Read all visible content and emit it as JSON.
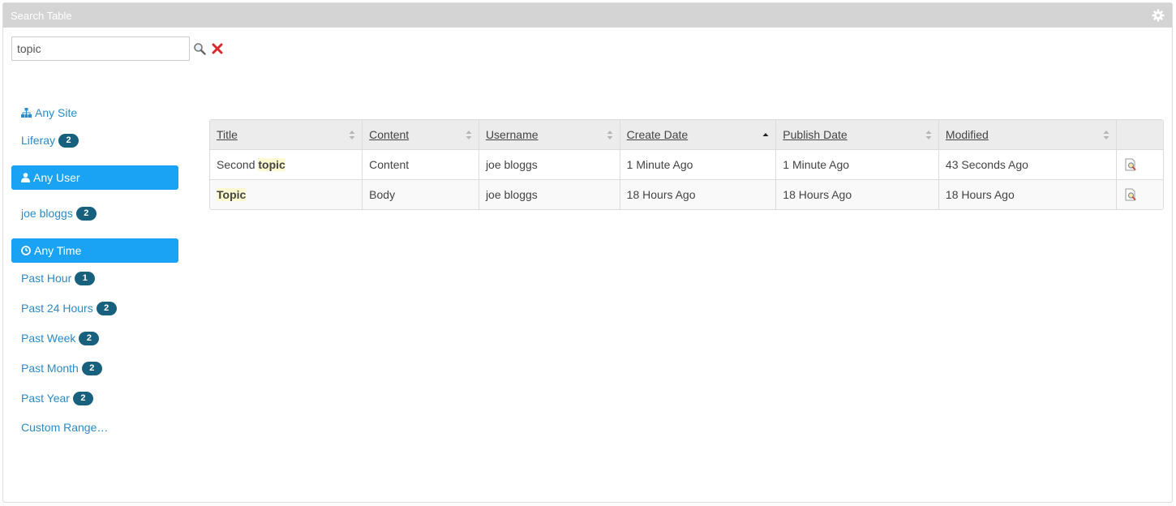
{
  "portlet": {
    "title": "Search Table",
    "settings_icon": "gear-icon"
  },
  "search": {
    "value": "topic",
    "placeholder": "",
    "search_icon": "magnifier-icon",
    "clear_icon": "red-x-icon"
  },
  "facets": {
    "site": {
      "header": "Any Site",
      "header_icon": "sitemap-icon",
      "items": [
        {
          "label": "Liferay",
          "count": "2"
        }
      ]
    },
    "user": {
      "header": "Any User",
      "header_icon": "user-icon",
      "items": [
        {
          "label": "joe bloggs",
          "count": "2"
        }
      ]
    },
    "time": {
      "header": "Any Time",
      "header_icon": "clock-icon",
      "items": [
        {
          "label": "Past Hour",
          "count": "1"
        },
        {
          "label": "Past 24 Hours",
          "count": "2"
        },
        {
          "label": "Past Week",
          "count": "2"
        },
        {
          "label": "Past Month",
          "count": "2"
        },
        {
          "label": "Past Year",
          "count": "2"
        }
      ],
      "custom_range": "Custom Range…"
    },
    "active_color": "#1aa3f4",
    "badge_color": "#17617f",
    "link_color": "#2a8bc8"
  },
  "table": {
    "columns": [
      "Title",
      "Content",
      "Username",
      "Create Date",
      "Publish Date",
      "Modified"
    ],
    "sorted_column": "Create Date",
    "sort_direction": "ascending",
    "rows": [
      {
        "title_prefix": "Second ",
        "title_highlight": "topic",
        "content": "Content",
        "username": "joe bloggs",
        "create_date": "1 Minute Ago",
        "publish_date": "1 Minute Ago",
        "modified": "43 Seconds Ago",
        "action_icon": "preview-icon"
      },
      {
        "title_prefix": "",
        "title_highlight": "Topic",
        "content": "Body",
        "username": "joe bloggs",
        "create_date": "18 Hours Ago",
        "publish_date": "18 Hours Ago",
        "modified": "18 Hours Ago",
        "action_icon": "preview-icon"
      }
    ]
  }
}
